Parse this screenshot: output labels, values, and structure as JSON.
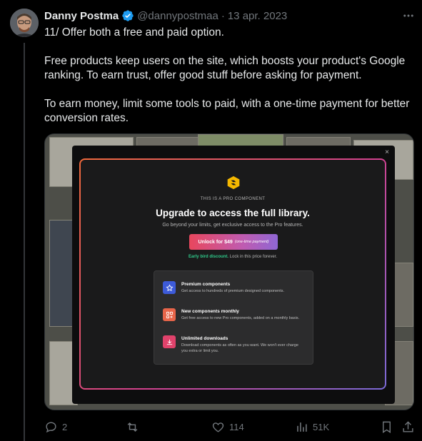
{
  "author": {
    "name": "Danny Postma",
    "handle": "@dannypostmaa",
    "separator": "·",
    "date": "13 apr. 2023"
  },
  "tweet": {
    "paragraphs": [
      "11/ Offer both a free and paid option.",
      "Free products keep users on the site, which boosts your product's Google ranking. To earn trust, offer good stuff before asking for payment.",
      "To earn money, limit some tools to paid, with a one-time payment for better conversion rates."
    ]
  },
  "media": {
    "close_glyph": "×",
    "pro_tag": "THIS IS A PRO COMPONENT",
    "title": "Upgrade to access the full library.",
    "subtitle": "Go beyond your limits, get exclusive access to the Pro features.",
    "unlock_price": "Unlock for $49",
    "unlock_note": "(one-time payment)",
    "early_highlight": "Early bird discount.",
    "early_rest": "Lock in this price forever.",
    "features": [
      {
        "title": "Premium components",
        "desc": "Get access to hundreds of premium designed components.",
        "icon": "star-icon",
        "color": "#3d5bd9"
      },
      {
        "title": "New components monthly",
        "desc": "Get free access to new Pro components, added on a monthly basis.",
        "icon": "grid-plus-icon",
        "color": "#e8654a"
      },
      {
        "title": "Unlimited downloads",
        "desc": "Download components as often as you want. We won't ever charge you extra or limit you.",
        "icon": "download-icon",
        "color": "#e0426b"
      }
    ]
  },
  "actions": {
    "replies": "2",
    "retweets": "",
    "likes": "114",
    "views": "51K"
  },
  "colors": {
    "background": "#000000",
    "text": "#e7e9ea",
    "muted": "#71767b",
    "verified": "#1d9bf0",
    "early_bird": "#2fc98a",
    "logo": "#f5b800"
  }
}
